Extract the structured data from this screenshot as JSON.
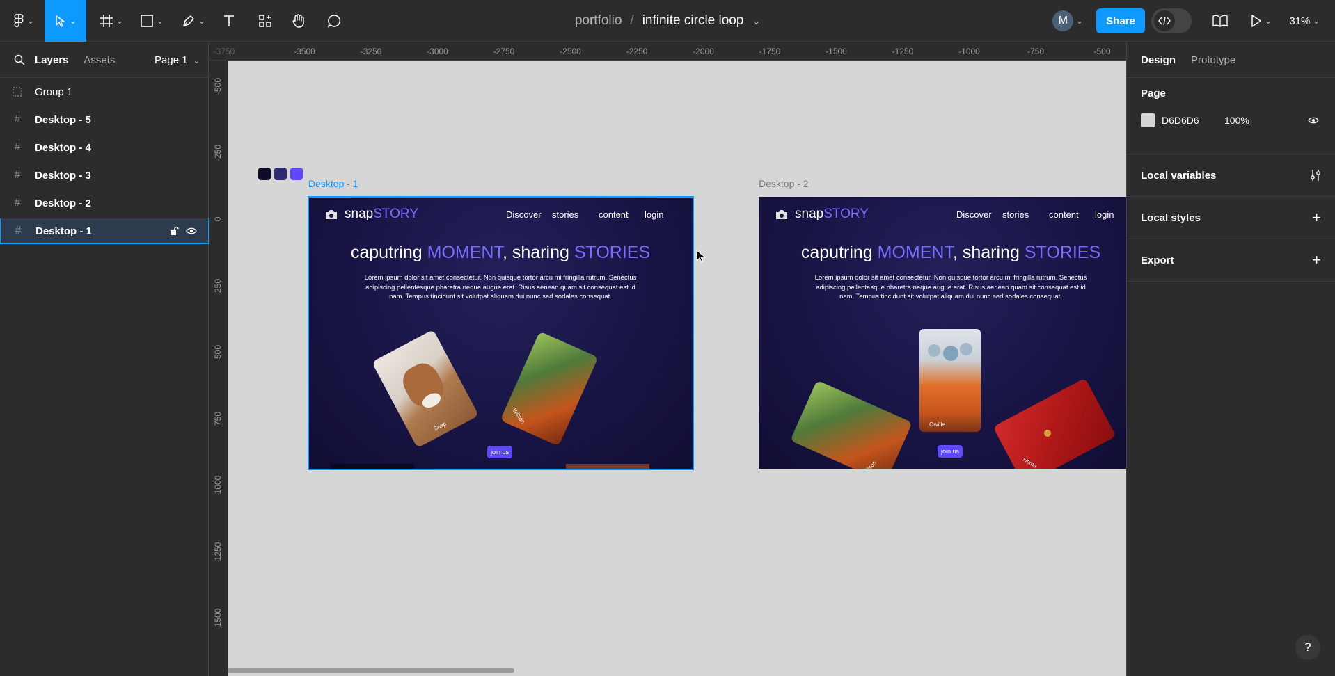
{
  "toolbar": {
    "tools": [
      "figma-menu",
      "move-tool",
      "frame-tool",
      "shape-tool",
      "pen-tool",
      "text-tool",
      "resources-tool",
      "hand-tool",
      "comment-tool"
    ],
    "project": "portfolio",
    "separator": "/",
    "file_name": "infinite circle loop",
    "avatar_initial": "M",
    "share_label": "Share",
    "zoom": "31%"
  },
  "left_panel": {
    "tabs": [
      "Layers",
      "Assets"
    ],
    "page_selector": "Page 1",
    "layers": [
      "Group 1",
      "Desktop - 5",
      "Desktop - 4",
      "Desktop - 3",
      "Desktop - 2",
      "Desktop - 1"
    ],
    "selected_layer": "Desktop - 1"
  },
  "ruler": {
    "top": [
      "-3750",
      "-3500",
      "-3250",
      "-3000",
      "-2750",
      "-2500",
      "-2250",
      "-2000",
      "-1750",
      "-1500",
      "-1250",
      "-1000",
      "-750",
      "-500"
    ],
    "left": [
      "-500",
      "-250",
      "0",
      "250",
      "500",
      "750",
      "1000",
      "1250",
      "1500"
    ]
  },
  "right_panel": {
    "tabs": [
      "Design",
      "Prototype"
    ],
    "page_label": "Page",
    "page_color": "D6D6D6",
    "page_opacity": "100%",
    "local_variables": "Local variables",
    "local_styles": "Local styles",
    "export": "Export"
  },
  "canvas": {
    "background": "#d6d6d6",
    "swatches": [
      "#0f0c2a",
      "#2e2a70",
      "#5b48ff"
    ],
    "frames": [
      {
        "label": "Desktop - 1",
        "logo_a": "snap",
        "logo_b": "STORY",
        "nav": [
          "Discover",
          "stories",
          "content",
          "login"
        ],
        "hero_a": "caputring ",
        "hero_b": "MOMENT",
        "hero_c": ", sharing ",
        "hero_d": "STORIES",
        "body": "Lorem ipsum dolor sit amet consectetur. Non quisque tortor arcu mi fringilla rutrum. Senectus adipiscing pellentesque pharetra neque augue erat. Risus aenean quam sit consequat est id nam. Tempus tincidunt sit volutpat aliquam dui nunc sed sodales consequat.",
        "cards": [
          "Snap",
          "Wilson"
        ],
        "button": "join us"
      },
      {
        "label": "Desktop - 2",
        "logo_a": "snap",
        "logo_b": "STORY",
        "nav": [
          "Discover",
          "stories",
          "content",
          "login"
        ],
        "hero_a": "caputring ",
        "hero_b": "MOMENT",
        "hero_c": ", sharing ",
        "hero_d": "STORIES",
        "body": "Lorem ipsum dolor sit amet consectetur. Non quisque tortor arcu mi fringilla rutrum. Senectus adipiscing pellentesque pharetra neque augue erat. Risus aenean quam sit consequat est id nam. Tempus tincidunt sit volutpat aliquam dui nunc sed sodales consequat.",
        "cards": [
          "Wilson",
          "Orville",
          "Home"
        ],
        "button": "join us"
      }
    ]
  },
  "colors": {
    "accent": "#0d99ff",
    "brand_purple": "#7b6cff",
    "button": "#5b48ff"
  }
}
